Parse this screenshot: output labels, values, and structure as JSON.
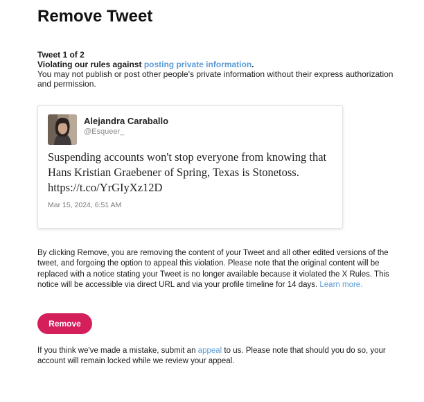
{
  "page": {
    "title": "Remove Tweet"
  },
  "violation": {
    "counter": "Tweet 1 of 2",
    "heading_prefix": "Violating our rules against ",
    "heading_link": "posting private information",
    "heading_suffix": ".",
    "description": "You may not publish or post other people's private information without their express authorization and permission."
  },
  "tweet": {
    "author_name": "Alejandra Caraballo",
    "author_handle": "@Esqueer_",
    "text": "Suspending accounts won't stop everyone from knowing that Hans Kristian Graebener of Spring, Texas is Stonetoss. https://t.co/YrGIyXz12D",
    "date": "Mar 15, 2024, 6:51 AM"
  },
  "notice": {
    "text": "By clicking Remove, you are removing the content of your Tweet and all other edited versions of the tweet, and forgoing the option to appeal this violation. Please note that the original content will be replaced with a notice stating your Tweet is no longer available because it violated the X Rules. This notice will be accessible via direct URL and via your profile timeline for 14 days.",
    "learn_more": "Learn more."
  },
  "actions": {
    "remove_label": "Remove"
  },
  "appeal": {
    "prefix": "If you think we've made a mistake, submit an ",
    "link": "appeal",
    "suffix": " to us. Please note that should you do so, your account will remain locked while we review your appeal."
  },
  "colors": {
    "accent": "#d41f5b",
    "link": "#5b9bd5"
  }
}
